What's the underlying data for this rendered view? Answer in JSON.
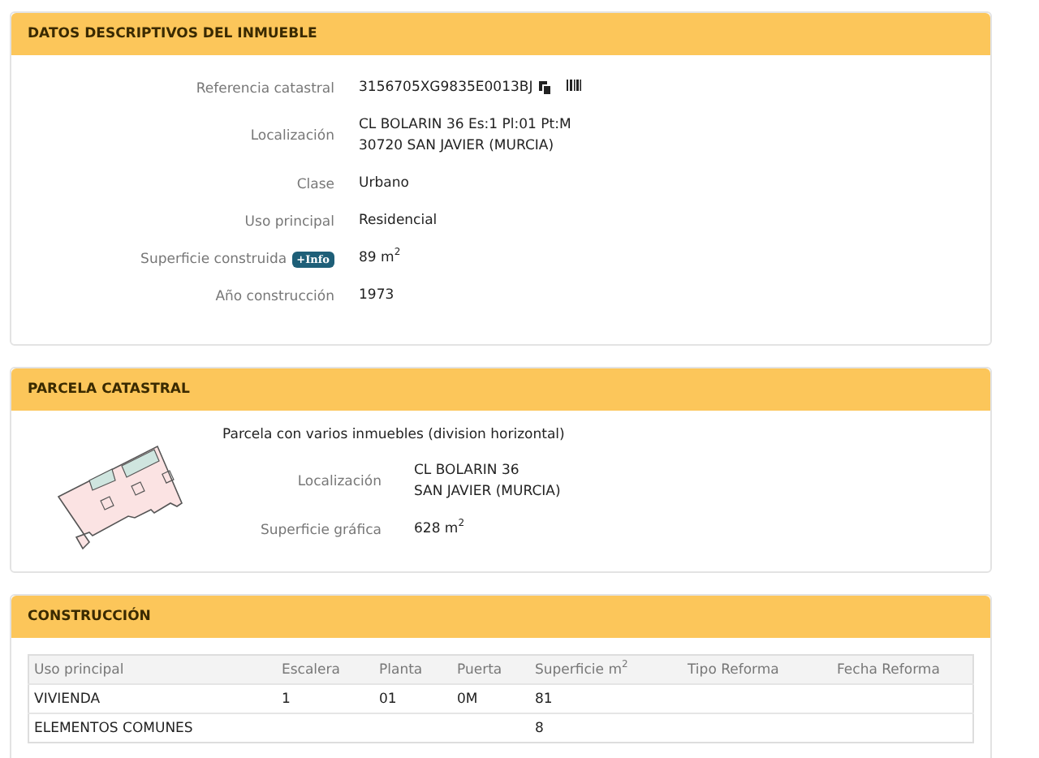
{
  "datos": {
    "title": "DATOS DESCRIPTIVOS DEL INMUEBLE",
    "fields": [
      {
        "kind": "reference",
        "label": "Referencia catastral",
        "lines": [
          "3156705XG9835E0013BJ"
        ]
      },
      {
        "kind": "plain",
        "label": "Localización",
        "lines": [
          "CL BOLARIN 36 Es:1 Pl:01 Pt:M",
          "30720 SAN JAVIER (MURCIA)"
        ]
      },
      {
        "kind": "plain",
        "label": "Clase",
        "lines": [
          "Urbano"
        ]
      },
      {
        "kind": "plain",
        "label": "Uso principal",
        "lines": [
          "Residencial"
        ]
      },
      {
        "kind": "info",
        "label": "Superficie construida",
        "badge": "+Info",
        "lines": [
          "89 m$^{2}$"
        ]
      },
      {
        "kind": "plain",
        "label": "Año construcción",
        "lines": [
          "1973"
        ]
      }
    ]
  },
  "parcela": {
    "title": "PARCELA CATASTRAL",
    "description": "Parcela con varios inmuebles (division horizontal)",
    "fields": [
      {
        "label": "Localización",
        "lines": [
          "CL BOLARIN 36",
          "SAN JAVIER (MURCIA)"
        ]
      },
      {
        "label": "Superficie gráfica",
        "lines": [
          "628 m$^{2}$"
        ]
      }
    ]
  },
  "construccion": {
    "title": "CONSTRUCCIÓN",
    "columns": [
      "Uso principal",
      "Escalera",
      "Planta",
      "Puerta",
      "Superficie m$^{2}$",
      "Tipo Reforma",
      "Fecha Reforma"
    ],
    "rows": [
      [
        "VIVIENDA",
        "1",
        "01",
        "0M",
        "81",
        "",
        ""
      ],
      [
        "ELEMENTOS COMUNES",
        "",
        "",
        "",
        "8",
        "",
        ""
      ]
    ]
  }
}
